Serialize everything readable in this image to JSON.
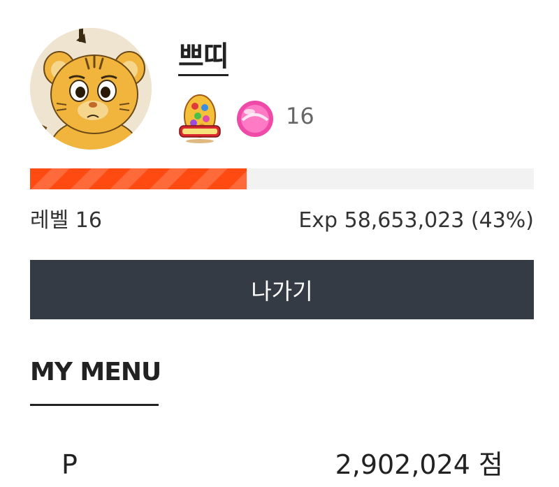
{
  "profile": {
    "username": "쁘띠",
    "avatar_icon": "tiger-cub-avatar",
    "badges": [
      "easter-egg-badge-icon",
      "candy-badge-icon"
    ],
    "badge_level": "16"
  },
  "progress": {
    "fraction": 0.43,
    "colors": {
      "fill": "#ff4a12",
      "track": "#f2f2f2"
    }
  },
  "level": {
    "label": "레벨 16",
    "exp_text": "Exp 58,653,023 (43%)"
  },
  "actions": {
    "logout_label": "나가기"
  },
  "my_menu": {
    "title": "MY MENU",
    "points_label": "P",
    "points_value": "2,902,024 점"
  },
  "colors": {
    "button_bg": "#343b45",
    "text": "#222222"
  }
}
